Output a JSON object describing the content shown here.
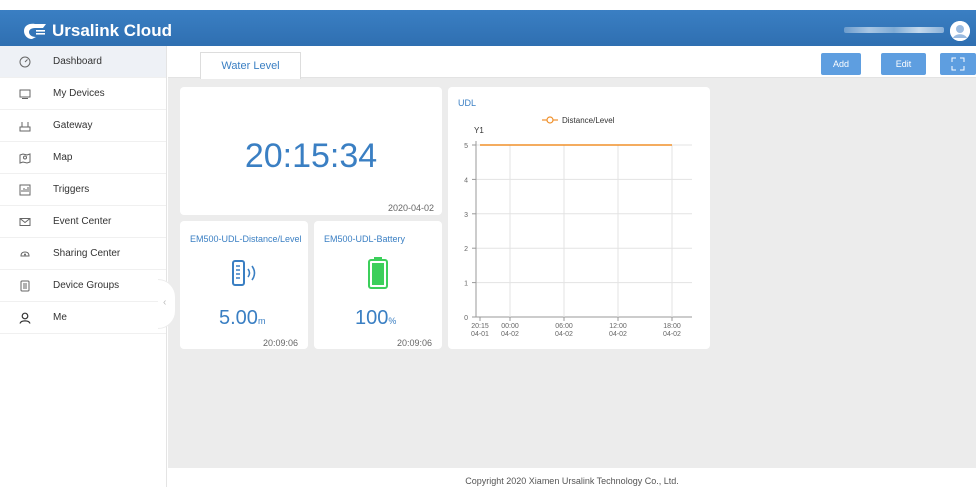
{
  "app": {
    "name": "Ursalink Cloud"
  },
  "sidebar": {
    "items": [
      {
        "label": "Dashboard",
        "icon": "dashboard-icon"
      },
      {
        "label": "My Devices",
        "icon": "device-icon"
      },
      {
        "label": "Gateway",
        "icon": "gateway-icon"
      },
      {
        "label": "Map",
        "icon": "map-icon"
      },
      {
        "label": "Triggers",
        "icon": "trigger-icon"
      },
      {
        "label": "Event Center",
        "icon": "envelope-icon"
      },
      {
        "label": "Sharing Center",
        "icon": "share-icon"
      },
      {
        "label": "Device Groups",
        "icon": "group-icon"
      },
      {
        "label": "Me",
        "icon": "user-icon"
      }
    ],
    "active": "Dashboard"
  },
  "tabs": [
    {
      "label": "Water Level"
    }
  ],
  "toolbar": {
    "add": "Add",
    "edit": "Edit"
  },
  "clock": {
    "time": "20:15:34",
    "date": "2020-04-02"
  },
  "widgets": {
    "distance": {
      "title": "EM500-UDL-Distance/Level",
      "value": "5.00",
      "unit": "m",
      "time": "20:09:06"
    },
    "battery": {
      "title": "EM500-UDL-Battery",
      "value": "100",
      "unit": "%",
      "time": "20:09:06"
    }
  },
  "footer": {
    "copyright": "Copyright 2020 Xiamen Ursalink Technology Co., Ltd."
  },
  "colors": {
    "brand": "#2f6fb1",
    "accent": "#3a7fc3",
    "button": "#5e9ee0",
    "line": "#f0902a",
    "battery": "#3ccf5b"
  },
  "chart_data": {
    "type": "line",
    "title": "UDL",
    "ylabel": "Y1",
    "series": [
      {
        "name": "Distance/Level",
        "values": [
          5,
          5,
          5,
          5,
          5
        ]
      }
    ],
    "x": [
      "20:15 04-01",
      "00:00 04-02",
      "06:00 04-02",
      "12:00 04-02",
      "18:00 04-02"
    ],
    "x_ticks": [
      {
        "time": "20:15",
        "date": "04-01"
      },
      {
        "time": "00:00",
        "date": "04-02"
      },
      {
        "time": "06:00",
        "date": "04-02"
      },
      {
        "time": "12:00",
        "date": "04-02"
      },
      {
        "time": "18:00",
        "date": "04-02"
      }
    ],
    "y_ticks": [
      "0",
      "1",
      "2",
      "3",
      "4",
      "5"
    ],
    "ylim": [
      0,
      5
    ],
    "grid": true,
    "legend": "top"
  }
}
